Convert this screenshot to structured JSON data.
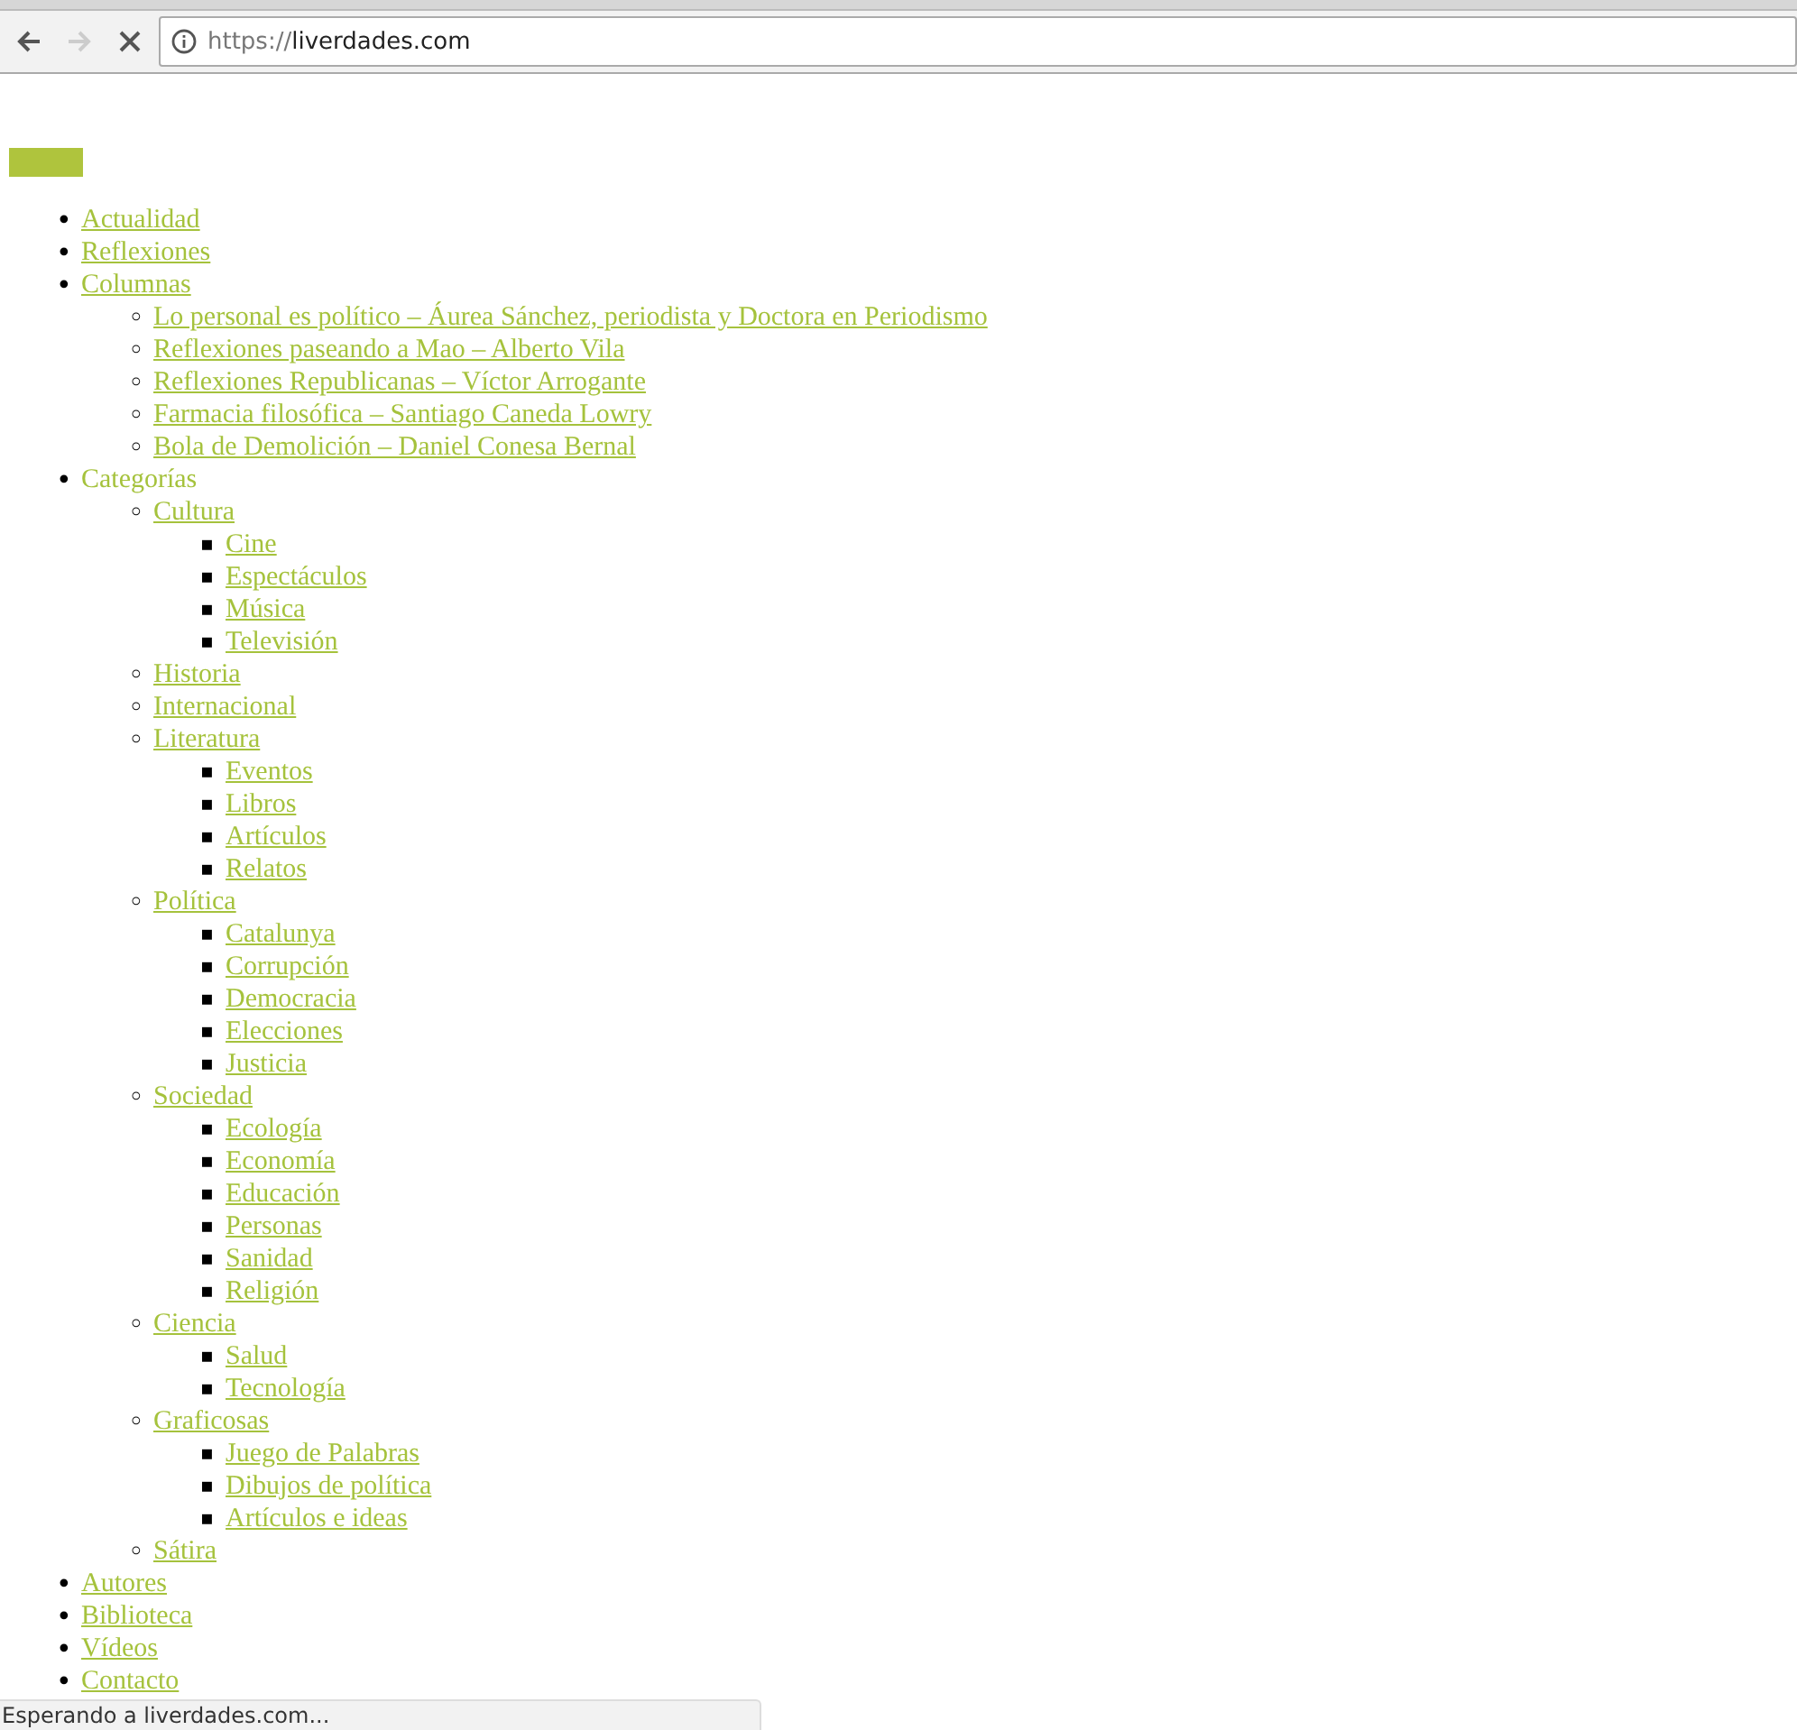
{
  "browser": {
    "url_scheme": "https://",
    "url_host": "liverdades.com",
    "status": "Esperando a liverdades.com..."
  },
  "markers": [
    "•",
    "◦",
    "▪"
  ],
  "menu": [
    {
      "label": "Actualidad",
      "linked": true
    },
    {
      "label": "Reflexiones",
      "linked": true
    },
    {
      "label": "Columnas",
      "linked": true,
      "children": [
        {
          "label": "Lo personal es político – Áurea Sánchez, periodista y Doctora en Periodismo",
          "linked": true
        },
        {
          "label": "Reflexiones paseando a Mao – Alberto Vila",
          "linked": true
        },
        {
          "label": "Reflexiones Republicanas – Víctor Arrogante",
          "linked": true
        },
        {
          "label": "Farmacia filosófica – Santiago Caneda Lowry",
          "linked": true
        },
        {
          "label": "Bola de Demolición – Daniel Conesa Bernal",
          "linked": true
        }
      ]
    },
    {
      "label": "Categorías",
      "linked": false,
      "children": [
        {
          "label": "Cultura",
          "linked": true,
          "children": [
            {
              "label": "Cine",
              "linked": true
            },
            {
              "label": "Espectáculos",
              "linked": true
            },
            {
              "label": "Música",
              "linked": true
            },
            {
              "label": "Televisión",
              "linked": true
            }
          ]
        },
        {
          "label": "Historia",
          "linked": true
        },
        {
          "label": "Internacional",
          "linked": true
        },
        {
          "label": "Literatura",
          "linked": true,
          "children": [
            {
              "label": "Eventos",
              "linked": true
            },
            {
              "label": "Libros",
              "linked": true
            },
            {
              "label": "Artículos",
              "linked": true
            },
            {
              "label": "Relatos",
              "linked": true
            }
          ]
        },
        {
          "label": "Política",
          "linked": true,
          "children": [
            {
              "label": "Catalunya",
              "linked": true
            },
            {
              "label": "Corrupción",
              "linked": true
            },
            {
              "label": "Democracia",
              "linked": true
            },
            {
              "label": "Elecciones",
              "linked": true
            },
            {
              "label": "Justicia",
              "linked": true
            }
          ]
        },
        {
          "label": "Sociedad",
          "linked": true,
          "children": [
            {
              "label": "Ecología",
              "linked": true
            },
            {
              "label": "Economía",
              "linked": true
            },
            {
              "label": "Educación",
              "linked": true
            },
            {
              "label": "Personas",
              "linked": true
            },
            {
              "label": "Sanidad",
              "linked": true
            },
            {
              "label": "Religión",
              "linked": true
            }
          ]
        },
        {
          "label": "Ciencia",
          "linked": true,
          "children": [
            {
              "label": "Salud",
              "linked": true
            },
            {
              "label": "Tecnología",
              "linked": true
            }
          ]
        },
        {
          "label": "Graficosas",
          "linked": true,
          "children": [
            {
              "label": "Juego de Palabras",
              "linked": true
            },
            {
              "label": "Dibujos de política",
              "linked": true
            },
            {
              "label": "Artículos e ideas",
              "linked": true
            }
          ]
        },
        {
          "label": "Sátira",
          "linked": true
        }
      ]
    },
    {
      "label": "Autores",
      "linked": true
    },
    {
      "label": "Biblioteca",
      "linked": true
    },
    {
      "label": "Vídeos",
      "linked": true
    },
    {
      "label": "Contacto",
      "linked": true
    }
  ]
}
